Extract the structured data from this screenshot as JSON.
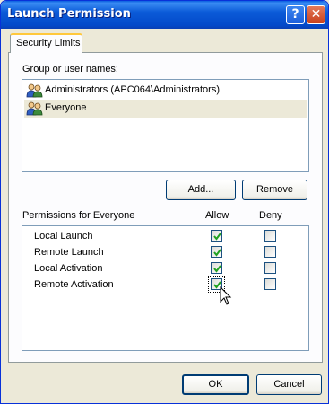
{
  "window": {
    "title": "Launch Permission",
    "help_label": "?",
    "close_label": "✕"
  },
  "tab": {
    "label": "Security Limits"
  },
  "groups": {
    "label": "Group or user names:",
    "items": [
      {
        "label": "Administrators (APC064\\Administrators)",
        "icon": "users-group-icon",
        "selected": false
      },
      {
        "label": "Everyone",
        "icon": "users-group-icon",
        "selected": true
      }
    ],
    "add_label": "Add...",
    "remove_label": "Remove"
  },
  "permissions": {
    "header": "Permissions for Everyone",
    "allow_header": "Allow",
    "deny_header": "Deny",
    "rows": [
      {
        "label": "Local Launch",
        "allow": true,
        "deny": false
      },
      {
        "label": "Remote Launch",
        "allow": true,
        "deny": false
      },
      {
        "label": "Local Activation",
        "allow": true,
        "deny": false
      },
      {
        "label": "Remote Activation",
        "allow": true,
        "deny": false
      }
    ]
  },
  "footer": {
    "ok_label": "OK",
    "cancel_label": "Cancel"
  },
  "colors": {
    "titlebar": "#0349C9",
    "check": "#21A121",
    "face": "#ECE9D8"
  }
}
